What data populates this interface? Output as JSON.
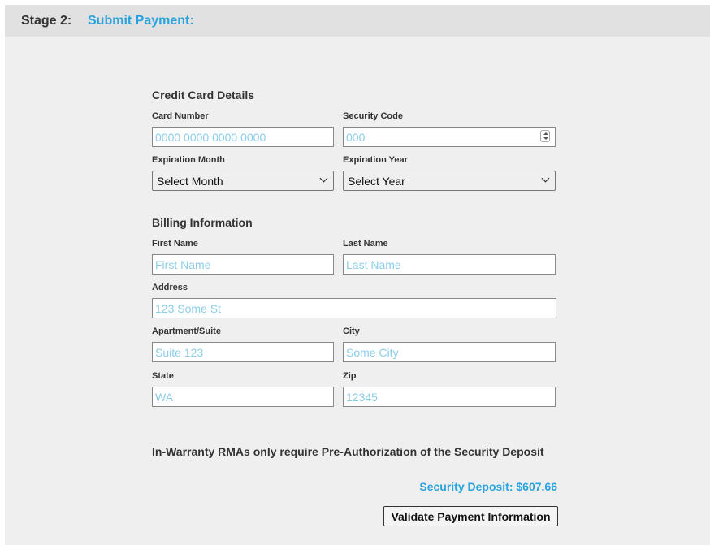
{
  "stage": {
    "label": "Stage 2:",
    "title": "Submit Payment:"
  },
  "credit_card": {
    "section_title": "Credit Card Details",
    "card_number": {
      "label": "Card Number",
      "placeholder": "0000 0000 0000 0000"
    },
    "security_code": {
      "label": "Security Code",
      "placeholder": "000"
    },
    "expiration_month": {
      "label": "Expiration Month",
      "selected": "Select Month"
    },
    "expiration_year": {
      "label": "Expiration Year",
      "selected": "Select Year"
    }
  },
  "billing": {
    "section_title": "Billing Information",
    "first_name": {
      "label": "First Name",
      "placeholder": "First Name"
    },
    "last_name": {
      "label": "Last Name",
      "placeholder": "Last Name"
    },
    "address": {
      "label": "Address",
      "placeholder": "123 Some St"
    },
    "apartment": {
      "label": "Apartment/Suite",
      "placeholder": "Suite 123"
    },
    "city": {
      "label": "City",
      "placeholder": "Some City"
    },
    "state": {
      "label": "State",
      "placeholder": "WA"
    },
    "zip": {
      "label": "Zip",
      "placeholder": "12345"
    }
  },
  "notice": "In-Warranty RMAs only require Pre-Authorization of the Security Deposit",
  "security_deposit": "Security Deposit: $607.66",
  "validate_button": "Validate Payment Information",
  "colors": {
    "accent": "#29a3dd",
    "placeholder": "#8ccde9",
    "background": "#efefef",
    "header_bar": "#e1e1e1"
  }
}
